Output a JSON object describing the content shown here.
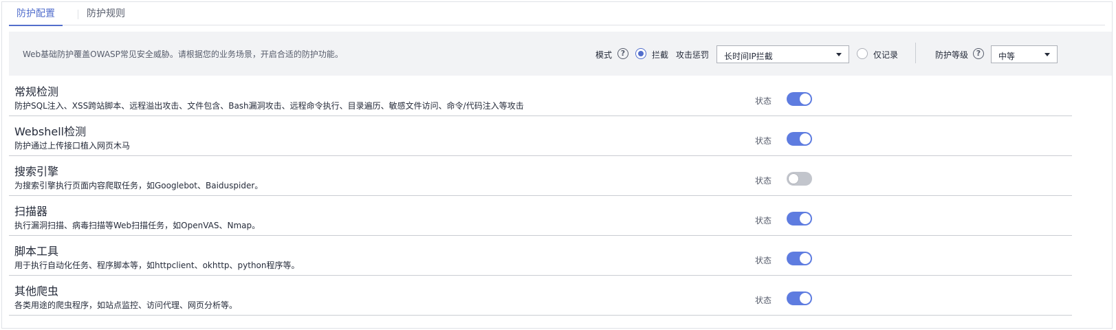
{
  "tabs": [
    {
      "label": "防护配置",
      "active": true
    },
    {
      "label": "防护规则",
      "active": false
    }
  ],
  "banner": {
    "description": "Web基础防护覆盖OWASP常见安全威胁。请根据您的业务场景，开启合适的防护功能。",
    "mode_label": "模式",
    "mode_options": [
      {
        "label": "拦截",
        "checked": true
      },
      {
        "label": "仅记录",
        "checked": false
      }
    ],
    "attack_penalty_label": "攻击惩罚",
    "attack_penalty_value": "长时间IP拦截",
    "protection_level_label": "防护等级",
    "protection_level_value": "中等"
  },
  "status_label": "状态",
  "rules": [
    {
      "title": "常规检测",
      "description": "防护SQL注入、XSS跨站脚本、远程溢出攻击、文件包含、Bash漏洞攻击、远程命令执行、目录遍历、敏感文件访问、命令/代码注入等攻击",
      "enabled": true
    },
    {
      "title": "Webshell检测",
      "description": "防护通过上传接口植入网页木马",
      "enabled": true
    },
    {
      "title": "搜索引擎",
      "description": "为搜索引擎执行页面内容爬取任务，如Googlebot、Baiduspider。",
      "enabled": false
    },
    {
      "title": "扫描器",
      "description": "执行漏洞扫描、病毒扫描等Web扫描任务，如OpenVAS、Nmap。",
      "enabled": true
    },
    {
      "title": "脚本工具",
      "description": "用于执行自动化任务、程序脚本等，如httpclient、okhttp、python程序等。",
      "enabled": true
    },
    {
      "title": "其他爬虫",
      "description": "各类用途的爬虫程序，如站点监控、访问代理、网页分析等。",
      "enabled": true
    }
  ],
  "colors": {
    "accent": "#526ecc",
    "switch_on": "#5e7ce0",
    "switch_off": "#c2c5cc",
    "banner_bg": "#f2f3f5"
  }
}
